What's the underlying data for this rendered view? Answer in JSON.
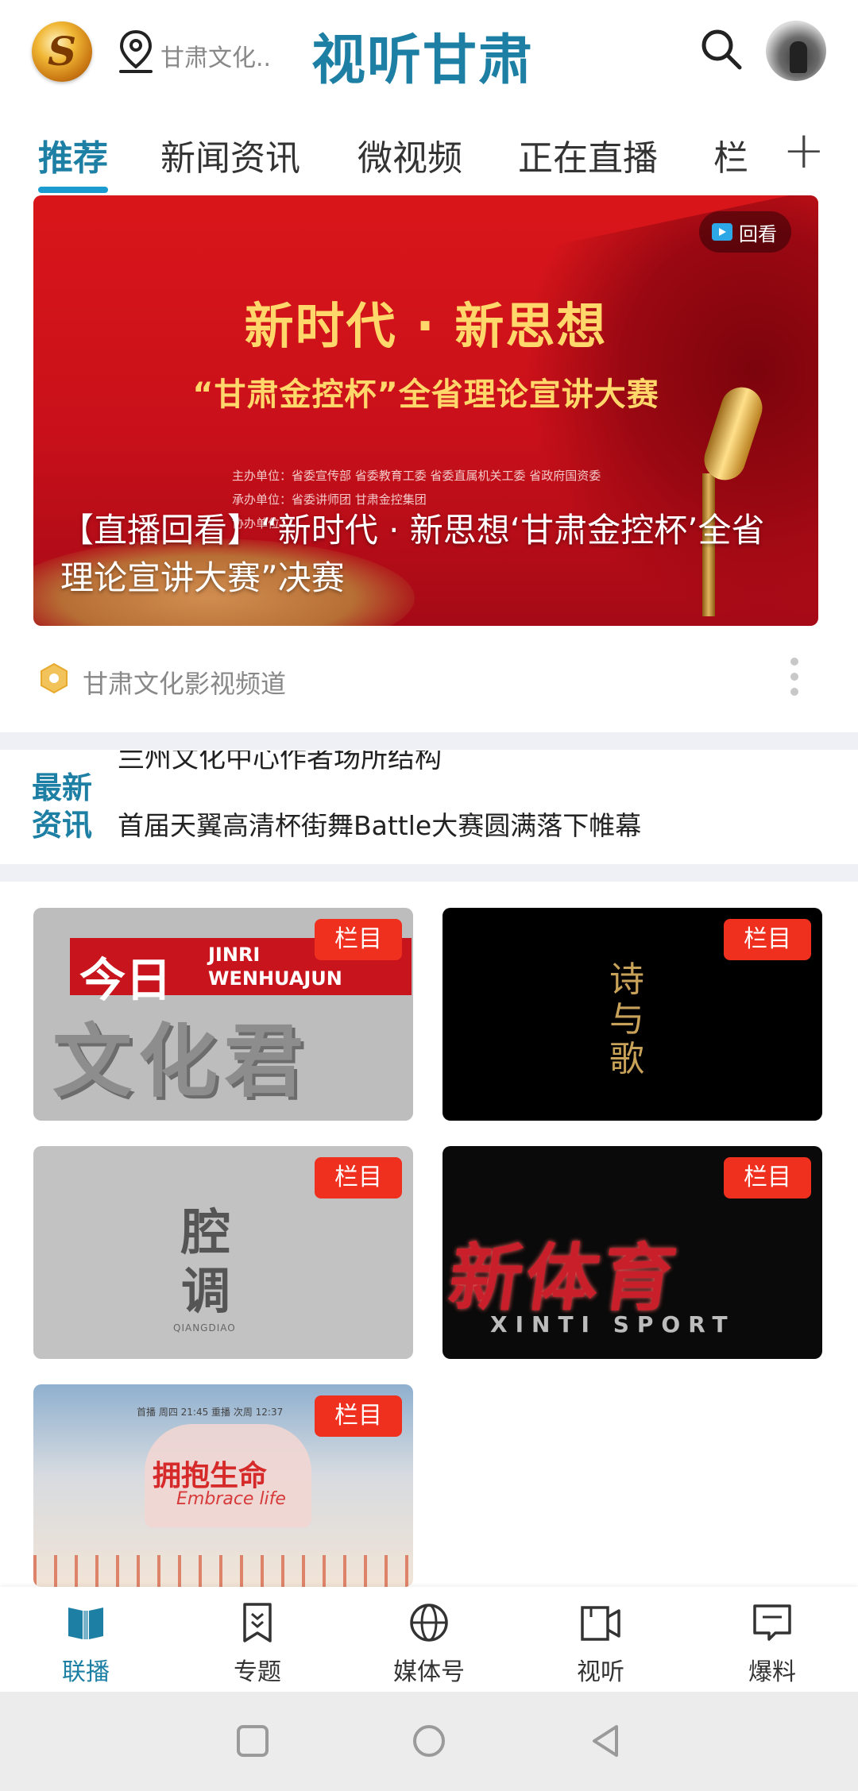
{
  "header": {
    "logo_letter": "S",
    "location_text": "甘肃文化..",
    "app_title": "视听甘肃"
  },
  "tabs": [
    {
      "label": "推荐",
      "active": true
    },
    {
      "label": "新闻资讯",
      "active": false
    },
    {
      "label": "微视频",
      "active": false
    },
    {
      "label": "正在直播",
      "active": false
    },
    {
      "label": "栏",
      "active": false
    }
  ],
  "tab_add_label": "+",
  "hero": {
    "badge_label": "回看",
    "title_line1": "新时代 · 新思想",
    "title_line2": "“甘肃金控杯”全省理论宣讲大赛",
    "small_line1": "主办单位：省委宣传部 省委教育工委 省委直属机关工委 省政府国资委",
    "small_line2": "承办单位：省委讲师团 甘肃金控集团",
    "small_line3": "协办单位：",
    "caption": "【直播回看】“新时代 · 新思想‘甘肃金控杯’全省理论宣讲大赛”决赛"
  },
  "channel": {
    "name": "甘肃文化影视频道"
  },
  "news_ticker": {
    "label_line1": "最新",
    "label_line2": "资讯",
    "previous_item": "兰州文化中心作者场所结构",
    "current_item": "首届天翼高清杯街舞Battle大赛圆满落下帷幕"
  },
  "cards": [
    {
      "badge": "栏目",
      "logo_cn_small": "今日",
      "logo_en_line1": "JINRI",
      "logo_en_line2": "WENHUAJUN",
      "logo_cn_big": "文化君"
    },
    {
      "badge": "栏目",
      "logo_text": "诗与歌"
    },
    {
      "badge": "栏目",
      "logo_text": "腔调",
      "logo_en": "QIANGDIAO"
    },
    {
      "badge": "栏目",
      "logo_text": "新体育",
      "logo_en": "XINTI SPORT"
    },
    {
      "badge": "栏目",
      "top_text": "首播 周四 21:45    重播 次周 12:37",
      "logo_text": "拥抱生命",
      "logo_en": "Embrace life"
    }
  ],
  "bottom_nav": [
    {
      "label": "联播",
      "icon": "book-icon",
      "active": true
    },
    {
      "label": "专题",
      "icon": "bookmark-icon",
      "active": false
    },
    {
      "label": "媒体号",
      "icon": "globe-icon",
      "active": false
    },
    {
      "label": "视听",
      "icon": "video-camera-icon",
      "active": false
    },
    {
      "label": "爆料",
      "icon": "message-icon",
      "active": false
    }
  ],
  "colors": {
    "accent": "#1c7fa3",
    "badge_red": "#f0301e",
    "hero_red": "#d9161a",
    "hero_gold": "#ffd76a"
  }
}
